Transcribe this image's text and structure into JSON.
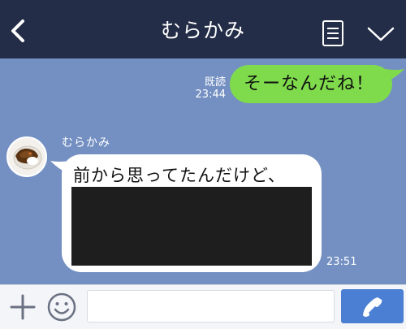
{
  "header": {
    "title": "むらかみ",
    "back_icon": "chevron-left-icon",
    "notes_icon": "note-list-icon",
    "menu_icon": "chevron-down-icon"
  },
  "messages": {
    "outgoing": {
      "read_label": "既読",
      "time": "23:44",
      "text": "そーなんだね！"
    },
    "incoming": {
      "sender": "むらかみ",
      "text": "前から思ってたんだけど、",
      "time": "23:51"
    }
  },
  "input_bar": {
    "plus_icon": "plus-icon",
    "emoji_icon": "smiley-icon",
    "message_value": "",
    "call_icon": "phone-icon"
  },
  "colors": {
    "header_bg": "#232d47",
    "chat_bg": "#7490c2",
    "outgoing_bubble": "#7fdb4c",
    "incoming_bubble": "#ffffff",
    "call_button": "#4a7fd4"
  }
}
